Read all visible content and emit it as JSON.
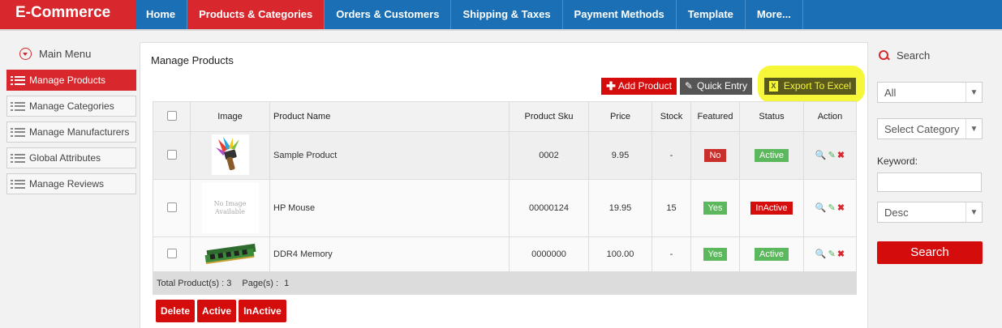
{
  "brand": "E-Commerce",
  "nav": [
    "Home",
    "Products & Categories",
    "Orders & Customers",
    "Shipping & Taxes",
    "Payment Methods",
    "Template",
    "More..."
  ],
  "nav_active": 1,
  "sidebar": {
    "title": "Main Menu",
    "items": [
      "Manage Products",
      "Manage Categories",
      "Manage Manufacturers",
      "Global Attributes",
      "Manage Reviews"
    ]
  },
  "panel": {
    "title": "Manage Products",
    "add_label": "Add Product",
    "quick_label": "Quick Entry",
    "export_label": "Export To Excel",
    "columns": [
      "Image",
      "Product Name",
      "Product Sku",
      "Price",
      "Stock",
      "Featured",
      "Status",
      "Action"
    ],
    "rows": [
      {
        "name": "Sample Product",
        "sku": "0002",
        "price": "9.95",
        "stock": "-",
        "featured": "No",
        "status": "Active"
      },
      {
        "name": "HP Mouse",
        "sku": "00000124",
        "price": "19.95",
        "stock": "15",
        "featured": "Yes",
        "status": "InActive",
        "image_text": "No Image Available"
      },
      {
        "name": "DDR4 Memory",
        "sku": "0000000",
        "price": "100.00",
        "stock": "-",
        "featured": "Yes",
        "status": "Active"
      }
    ],
    "footer": {
      "total_label": "Total Product(s) :",
      "total": "3",
      "pages_label": "Page(s) :",
      "pages": "1"
    },
    "bulk": [
      "Delete",
      "Active",
      "InActive"
    ]
  },
  "search": {
    "title": "Search",
    "filter_value": "All",
    "category_value": "Select Category",
    "keyword_label": "Keyword:",
    "keyword_value": "",
    "order_value": "Desc",
    "button": "Search"
  },
  "colors": {
    "brand_red": "#d9282d",
    "nav_blue": "#1a6fb5",
    "highlight": "#f7f73a"
  }
}
